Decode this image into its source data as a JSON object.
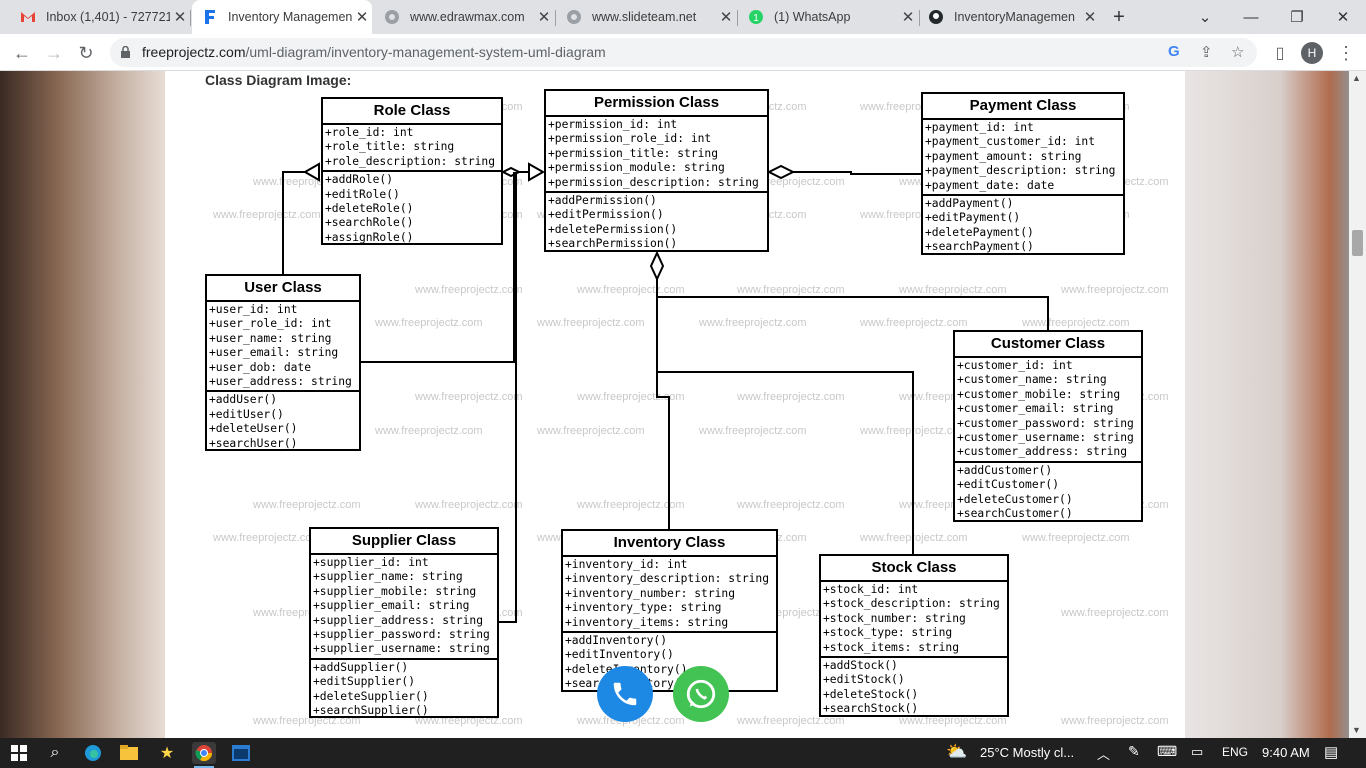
{
  "tabs": [
    {
      "title": "Inbox (1,401) - 727721",
      "icon": "gmail-icon",
      "color": "#ea4335"
    },
    {
      "title": "Inventory Managemen",
      "icon": "freeprojectz-icon",
      "color": "#1a73e8",
      "active": true
    },
    {
      "title": "www.edrawmax.com",
      "icon": "globe-icon",
      "color": "#9aa0a6"
    },
    {
      "title": "www.slideteam.net",
      "icon": "globe-icon",
      "color": "#9aa0a6"
    },
    {
      "title": "(1) WhatsApp",
      "icon": "whatsapp-icon",
      "color": "#25d366"
    },
    {
      "title": "InventoryManagemen",
      "icon": "github-icon",
      "color": "#24292e"
    }
  ],
  "toolbar": {
    "url_domain": "freeprojectz.com",
    "url_path": "/uml-diagram/inventory-management-system-uml-diagram",
    "profile_initial": "H"
  },
  "page": {
    "diagram_title": "Class Diagram Image:",
    "watermark": "www.freeprojectz.com"
  },
  "classes": {
    "role": {
      "name": "Role Class",
      "attributes": [
        "+role_id: int",
        "+role_title: string",
        "+role_description: string"
      ],
      "methods": [
        "+addRole()",
        "+editRole()",
        "+deleteRole()",
        "+searchRole()",
        "+assignRole()"
      ]
    },
    "permission": {
      "name": "Permission Class",
      "attributes": [
        "+permission_id: int",
        "+permission_role_id: int",
        "+permission_title: string",
        "+permission_module: string",
        "+permission_description: string"
      ],
      "methods": [
        "+addPermission()",
        "+editPermission()",
        "+deletePermission()",
        "+searchPermission()"
      ]
    },
    "payment": {
      "name": "Payment Class",
      "attributes": [
        "+payment_id: int",
        "+payment_customer_id: int",
        "+payment_amount: string",
        "+payment_description: string",
        "+payment_date: date"
      ],
      "methods": [
        "+addPayment()",
        "+editPayment()",
        "+deletePayment()",
        "+searchPayment()"
      ]
    },
    "user": {
      "name": "User Class",
      "attributes": [
        "+user_id: int",
        "+user_role_id: int",
        "+user_name: string",
        "+user_email: string",
        "+user_dob: date",
        "+user_address: string"
      ],
      "methods": [
        "+addUser()",
        "+editUser()",
        "+deleteUser()",
        "+searchUser()"
      ]
    },
    "customer": {
      "name": "Customer Class",
      "attributes": [
        "+customer_id: int",
        "+customer_name: string",
        "+customer_mobile: string",
        "+customer_email: string",
        "+customer_password: string",
        "+customer_username: string",
        "+customer_address: string"
      ],
      "methods": [
        "+addCustomer()",
        "+editCustomer()",
        "+deleteCustomer()",
        "+searchCustomer()"
      ]
    },
    "supplier": {
      "name": "Supplier Class",
      "attributes": [
        "+supplier_id: int",
        "+supplier_name: string",
        "+supplier_mobile: string",
        "+supplier_email: string",
        "+supplier_address: string",
        "+supplier_password: string",
        "+supplier_username: string"
      ],
      "methods": [
        "+addSupplier()",
        "+editSupplier()",
        "+deleteSupplier()",
        "+searchSupplier()"
      ]
    },
    "inventory": {
      "name": "Inventory Class",
      "attributes": [
        "+inventory_id: int",
        "+inventory_description: string",
        "+inventory_number: string",
        "+inventory_type: string",
        "+inventory_items: string"
      ],
      "methods": [
        "+addInventory()",
        "+editInventory()",
        "+deleteInventory()",
        "+searchInventory()"
      ]
    },
    "stock": {
      "name": "Stock Class",
      "attributes": [
        "+stock_id: int",
        "+stock_description: string",
        "+stock_number: string",
        "+stock_type: string",
        "+stock_items: string"
      ],
      "methods": [
        "+addStock()",
        "+editStock()",
        "+deleteStock()",
        "+searchStock()"
      ]
    }
  },
  "taskbar": {
    "weather": "25°C  Mostly cl...",
    "language": "ENG",
    "time": "9:40 AM"
  }
}
